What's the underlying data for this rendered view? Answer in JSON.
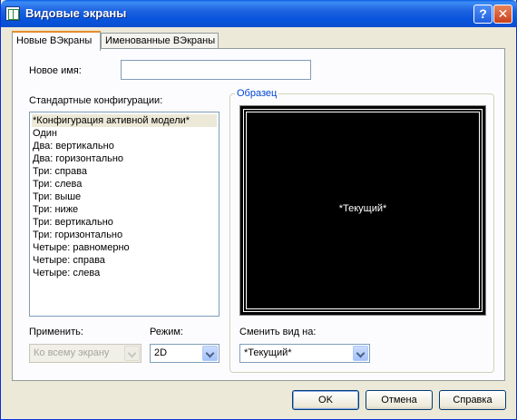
{
  "window": {
    "title": "Видовые экраны"
  },
  "tabs": [
    {
      "label": "Новые ВЭкраны"
    },
    {
      "label": "Именованные ВЭкраны"
    }
  ],
  "new_name": {
    "label": "Новое имя:",
    "value": ""
  },
  "std_configs": {
    "label": "Стандартные конфигурации:",
    "items": [
      "*Конфигурация активной модели*",
      "Один",
      "Два: вертикально",
      "Два: горизонтально",
      "Три: справа",
      "Три: слева",
      "Три: выше",
      "Три: ниже",
      "Три: вертикально",
      "Три: горизонтально",
      "Четыре: равномерно",
      "Четыре: справа",
      "Четыре: слева"
    ]
  },
  "preview": {
    "legend": "Образец",
    "text": "*Текущий*"
  },
  "apply": {
    "label": "Применить:",
    "value": "Ко всему экрану"
  },
  "mode": {
    "label": "Режим:",
    "value": "2D"
  },
  "change_view": {
    "label": "Сменить вид на:",
    "value": "*Текущий*"
  },
  "buttons": {
    "ok": "OK",
    "cancel": "Отмена",
    "help": "Справка"
  }
}
